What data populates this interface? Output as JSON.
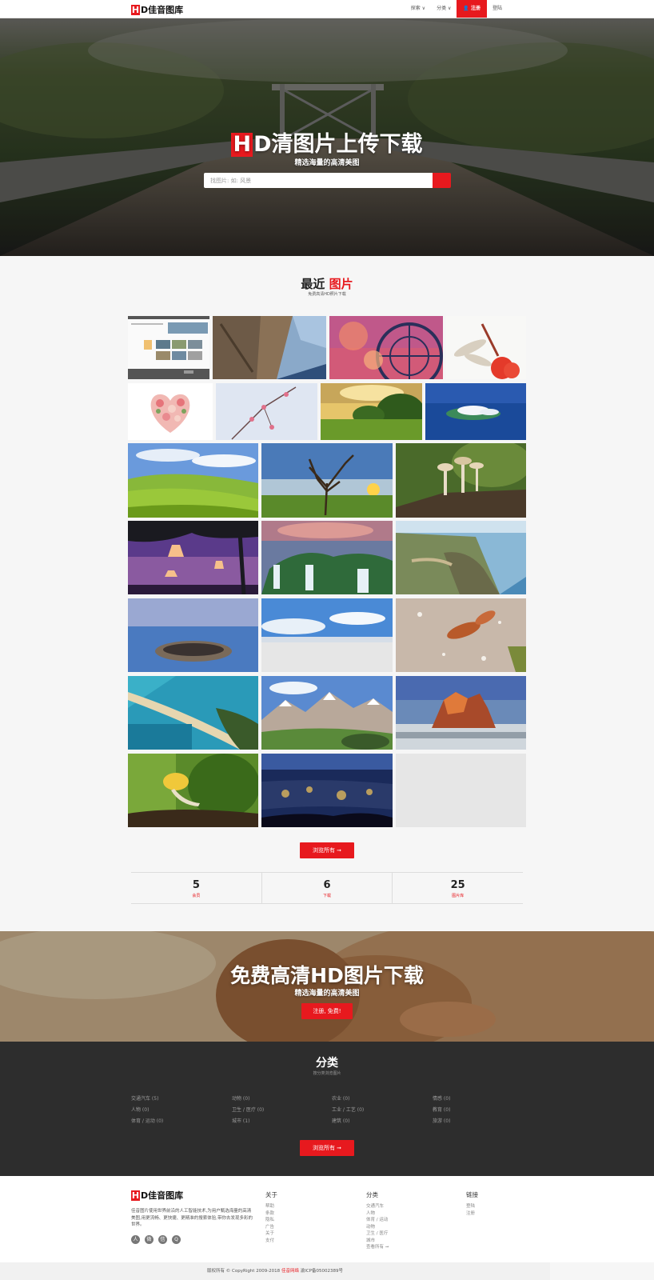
{
  "header": {
    "logo_h": "H",
    "logo_rest": "D佳音图库",
    "nav": [
      {
        "label": "探索 ∨"
      },
      {
        "label": "分类 ∨"
      },
      {
        "label": "注册"
      },
      {
        "label": "登陆"
      }
    ]
  },
  "hero": {
    "title_h": "H",
    "title_rest": "D清图片上传下载",
    "subtitle": "精选海量的高清美图",
    "search_placeholder": "找图片: 如: 风景"
  },
  "recent": {
    "title_black": "最近",
    "title_red": "图片",
    "subtitle": "免费高清HD照片下载",
    "browse_label": "浏览所有 ➞"
  },
  "stats": [
    {
      "value": "5",
      "label": "会员"
    },
    {
      "value": "6",
      "label": "下载"
    },
    {
      "value": "25",
      "label": "图片库"
    }
  ],
  "banner": {
    "title": "免费高清HD图片下载",
    "subtitle": "精选海量的高清美图",
    "button": "注册, 免费!"
  },
  "categories": {
    "title": "分类",
    "subtitle": "按分类浏览图片",
    "items": [
      "交通汽车 (5)",
      "动物 (0)",
      "农业 (0)",
      "情感 (0)",
      "人物 (0)",
      "卫生 / 医疗 (0)",
      "工业 / 工艺 (0)",
      "教育 (0)",
      "体育 / 运动 (0)",
      "城市 (1)",
      "建筑 (0)",
      "旅游 (0)"
    ],
    "browse_label": "浏览所有 ➞"
  },
  "footer": {
    "logo_h": "H",
    "logo_rest": "D佳音图库",
    "description": "佳音图片使用世界前沿的人工智能技术,为用户甄选海量的高清美图,用更流畅、更快捷、更精准的搜索体验,带你去发现多彩的世界。",
    "socials": [
      "人",
      "微",
      "信",
      "Q"
    ],
    "col_about": {
      "title": "关于",
      "links": [
        "帮助",
        "条款",
        "隐私",
        "广告",
        "关于",
        "支付"
      ]
    },
    "col_cats": {
      "title": "分类",
      "links": [
        "交通汽车",
        "人物",
        "体育 / 运动",
        "动物",
        "卫生 / 医疗",
        "城市",
        "查看所有 ➞"
      ]
    },
    "col_links": {
      "title": "链接",
      "links": [
        "登陆",
        "注册"
      ]
    }
  },
  "copyright": {
    "prefix": "版权所有 © CopyRight 2009-2018 ",
    "brand": "佳音网络",
    "suffix": " 渝ICP备05002389号"
  }
}
